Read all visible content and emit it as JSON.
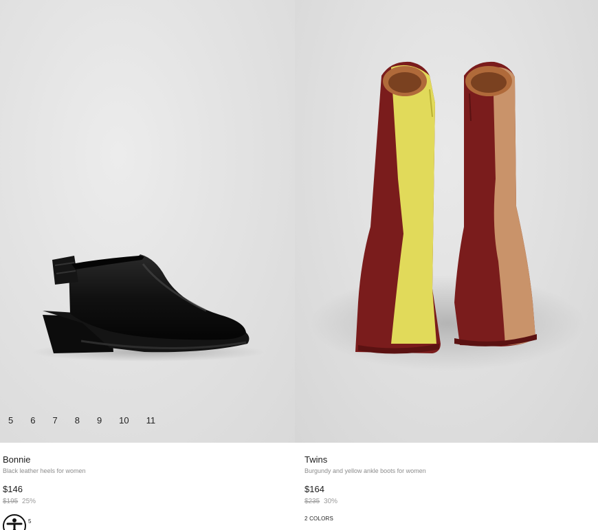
{
  "products": [
    {
      "name": "Bonnie",
      "description": "Black leather heels for women",
      "price": "$146",
      "old_price": "$195",
      "discount": "25%",
      "sizes": [
        "5",
        "6",
        "7",
        "8",
        "9",
        "10",
        "11"
      ],
      "image_icon": "black-slingback-heel-photo"
    },
    {
      "name": "Twins",
      "description": "Burgundy and yellow ankle boots for women",
      "price": "$164",
      "old_price": "$235",
      "discount": "30%",
      "colors_label": "2 COLORS",
      "image_icon": "burgundy-yellow-ankle-boots-photo"
    }
  ],
  "accessibility": {
    "icon": "accessibility-icon",
    "badge": "5"
  }
}
